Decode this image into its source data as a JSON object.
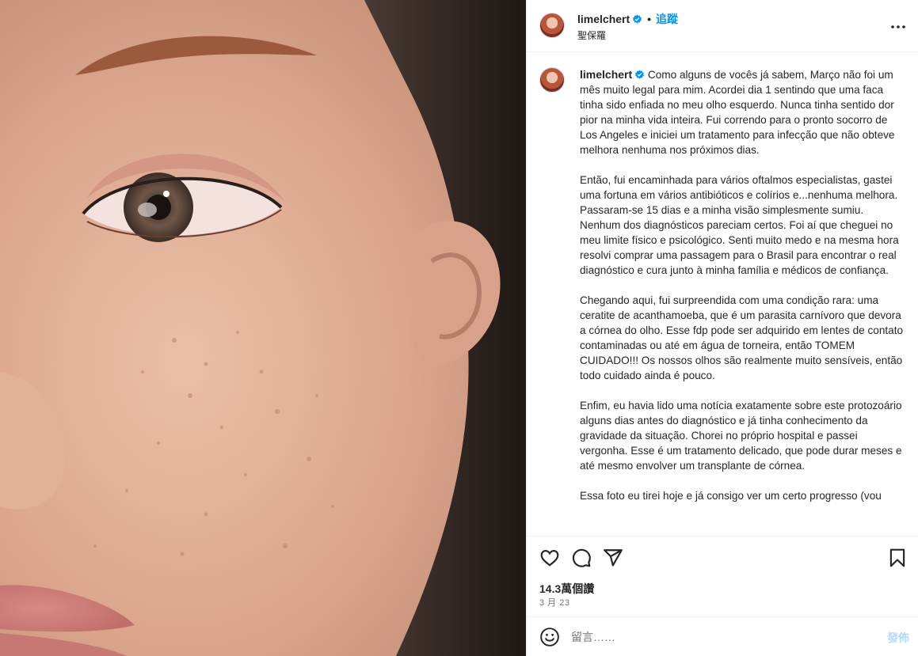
{
  "post": {
    "username": "limelchert",
    "follow_label": "追蹤",
    "separator": "•",
    "subtitle": "聖保羅",
    "caption_text": "Como alguns de vocês já sabem, Março não foi um mês muito legal para mim. Acordei dia 1 sentindo que uma faca tinha sido enfiada no meu olho esquerdo. Nunca tinha sentido dor pior na minha vida inteira. Fui correndo para o pronto socorro de Los Angeles e iniciei um tratamento para infecção que não obteve melhora nenhuma nos próximos dias.\n\nEntão, fui encaminhada para vários oftalmos especialistas, gastei uma fortuna em vários antibióticos e colírios e...nenhuma melhora. Passaram-se 15 dias e a minha visão simplesmente sumiu. Nenhum dos diagnósticos pareciam certos. Foi aí que cheguei no meu limite físico e psicológico. Senti muito medo e na mesma hora resolvi comprar uma passagem para o Brasil para encontrar o real diagnóstico e cura junto à minha família e médicos de confiança.\n\nChegando aqui, fui surpreendida com uma condição rara: uma ceratite de acanthamoeba, que é um parasita carnívoro que devora a córnea do olho. Esse fdp pode ser adquirido em lentes de contato contaminadas ou até em água de torneira, então TOMEM CUIDADO!!! Os nossos olhos são realmente muito sensíveis, então todo cuidado ainda é pouco.\n\nEnfim, eu havia lido uma notícia exatamente sobre este protozoário alguns dias antes do diagnóstico e já tinha conhecimento da gravidade da situação. Chorei no próprio hospital e passei vergonha. Esse é um tratamento delicado, que pode durar meses e até mesmo envolver um transplante de córnea.\n\nEssa foto eu tirei hoje e já consigo ver um certo progresso (vou",
    "views": "14.3萬個讚",
    "date": "3 月 23"
  },
  "comment": {
    "placeholder": "留言……",
    "post_label": "發佈"
  },
  "icons": {
    "verified": "verified-badge-icon",
    "more": "more-options-icon",
    "like": "heart-icon",
    "comment": "comment-icon",
    "share": "share-icon",
    "save": "bookmark-icon",
    "emoji": "emoji-icon"
  },
  "colors": {
    "accent": "#0095f6",
    "post_disabled": "#b3dbff",
    "secondary_text": "#737373"
  }
}
